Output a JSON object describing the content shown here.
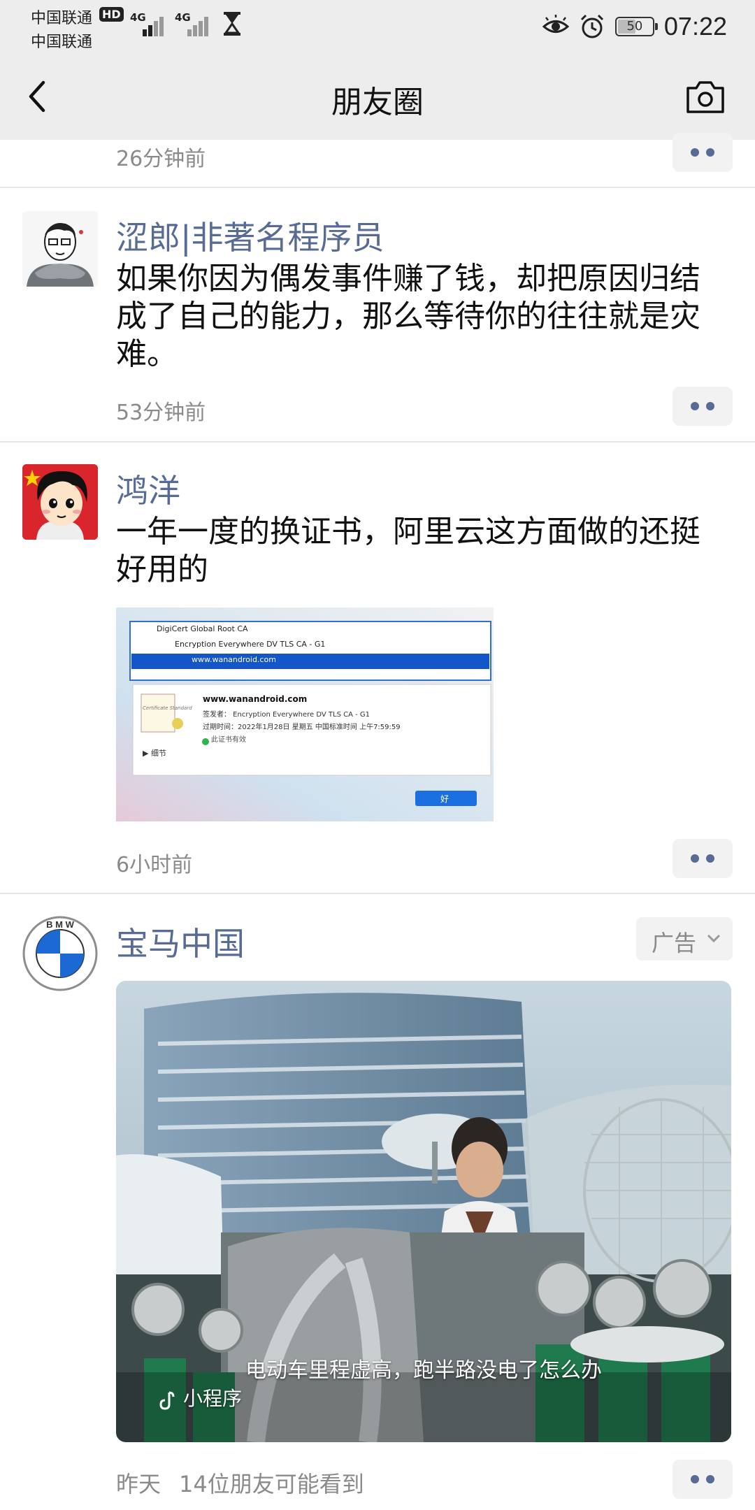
{
  "status_bar": {
    "carrier_1": "中国联通",
    "carrier_2": "中国联通",
    "hd_badge": "HD",
    "signal_1": "4G",
    "signal_2": "4G",
    "battery_level": "50",
    "time": "07:22"
  },
  "header": {
    "title": "朋友圈",
    "back_icon": "chevron-left-icon",
    "camera_icon": "camera-icon"
  },
  "feed": {
    "partial_post": {
      "time": "26分钟前"
    },
    "posts": [
      {
        "username": "涩郎|非著名程序员",
        "text": "如果你因为偶发事件赚了钱，却把原因归结成了自己的能力，那么等待你的往往就是灾难。",
        "time": "53分钟前"
      },
      {
        "username": "鸿洋",
        "text": "一年一度的换证书，阿里云这方面做的还挺好用的",
        "time": "6小时前",
        "image": {
          "root": "DigiCert Global Root CA",
          "intermediate": "Encryption Everywhere DV TLS CA - G1",
          "leaf": "www.wanandroid.com",
          "detail_title": "www.wanandroid.com",
          "issuer": "签发者： Encryption Everywhere DV TLS CA - G1",
          "expiry": "过期时间：2022年1月28日 星期五 中国标准时间 上午7:59:59",
          "valid": "此证书有效",
          "details": "细节",
          "ok_button": "好",
          "cert_badge": "Certificate Standard"
        }
      }
    ],
    "ad": {
      "username": "宝马中国",
      "logo_text": "BMW",
      "ad_label": "广告",
      "caption": "电动车里程虚高，跑半路没电了怎么办",
      "mini_program": "小程序",
      "time": "昨天",
      "visibility": "14位朋友可能看到"
    }
  },
  "colors": {
    "link_blue": "#576b95",
    "header_bg": "#ededed",
    "meta_gray": "#8a8a8a"
  }
}
